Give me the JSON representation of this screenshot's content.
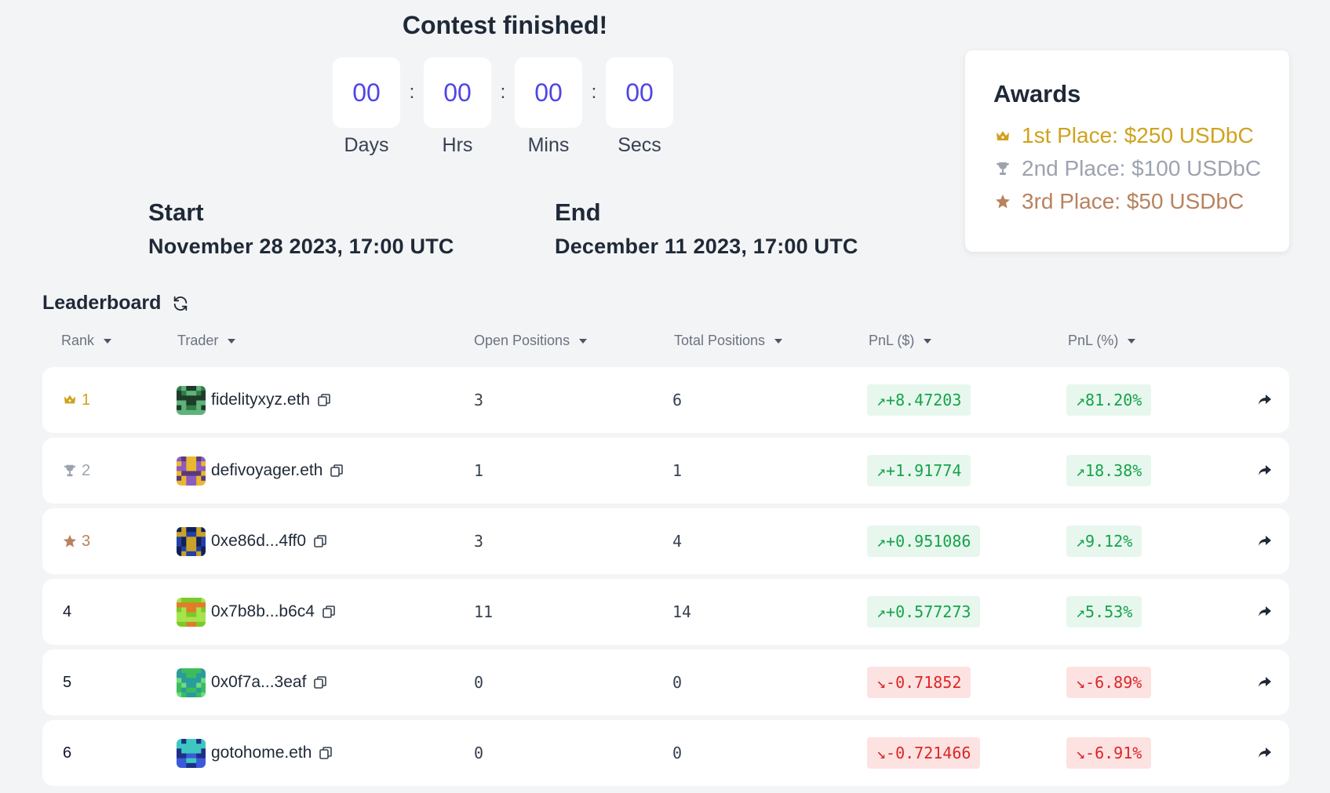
{
  "countdown": {
    "title": "Contest finished!",
    "units": [
      {
        "value": "00",
        "label": "Days"
      },
      {
        "value": "00",
        "label": "Hrs"
      },
      {
        "value": "00",
        "label": "Mins"
      },
      {
        "value": "00",
        "label": "Secs"
      }
    ],
    "separator": ":"
  },
  "schedule": {
    "start_label": "Start",
    "start_value": "November 28 2023, 17:00 UTC",
    "end_label": "End",
    "end_value": "December 11 2023, 17:00 UTC"
  },
  "awards": {
    "title": "Awards",
    "items": [
      {
        "text": "1st Place: $250 USDbC",
        "icon": "crown-icon",
        "color": "#cfa21e"
      },
      {
        "text": "2nd Place: $100 USDbC",
        "icon": "trophy-icon",
        "color": "#9ca3af"
      },
      {
        "text": "3rd Place: $50 USDbC",
        "icon": "star-icon",
        "color": "#b8825f"
      }
    ]
  },
  "leaderboard": {
    "title": "Leaderboard",
    "columns": [
      "Rank",
      "Trader",
      "Open Positions",
      "Total Positions",
      "PnL ($)",
      "PnL (%)"
    ],
    "rows": [
      {
        "rank": "1",
        "trader": "fidelityxyz.eth",
        "open": "3",
        "total": "6",
        "pnl": "↗+8.47203",
        "pct": "↗81.20%",
        "trend": "up",
        "medal": "crown-icon",
        "avatar_colors": [
          "#2e7d46",
          "#1f3b2a",
          "#5fb37a"
        ]
      },
      {
        "rank": "2",
        "trader": "defivoyager.eth",
        "open": "1",
        "total": "1",
        "pnl": "↗+1.91774",
        "pct": "↗18.38%",
        "trend": "up",
        "medal": "trophy-icon",
        "avatar_colors": [
          "#8e5bbf",
          "#e8b830",
          "#5a3a7a"
        ]
      },
      {
        "rank": "3",
        "trader": "0xe86d...4ff0",
        "open": "3",
        "total": "4",
        "pnl": "↗+0.951086",
        "pct": "↗9.12%",
        "trend": "up",
        "medal": "star-icon",
        "avatar_colors": [
          "#2340a8",
          "#c9a227",
          "#10205a"
        ]
      },
      {
        "rank": "4",
        "trader": "0x7b8b...b6c4",
        "open": "11",
        "total": "14",
        "pnl": "↗+0.577273",
        "pct": "↗5.53%",
        "trend": "up",
        "medal": "",
        "avatar_colors": [
          "#7cc928",
          "#e27b2a",
          "#a6e34d"
        ]
      },
      {
        "rank": "5",
        "trader": "0x0f7a...3eaf",
        "open": "0",
        "total": "0",
        "pnl": "↘-0.71852",
        "pct": "↘-6.89%",
        "trend": "down",
        "medal": "",
        "avatar_colors": [
          "#3bbd5c",
          "#2a9c9c",
          "#6fdc7f"
        ]
      },
      {
        "rank": "6",
        "trader": "gotohome.eth",
        "open": "0",
        "total": "0",
        "pnl": "↘-0.721466",
        "pct": "↘-6.91%",
        "trend": "down",
        "medal": "",
        "avatar_colors": [
          "#3a5bd9",
          "#3ec7c0",
          "#1e2f8a"
        ]
      }
    ]
  }
}
